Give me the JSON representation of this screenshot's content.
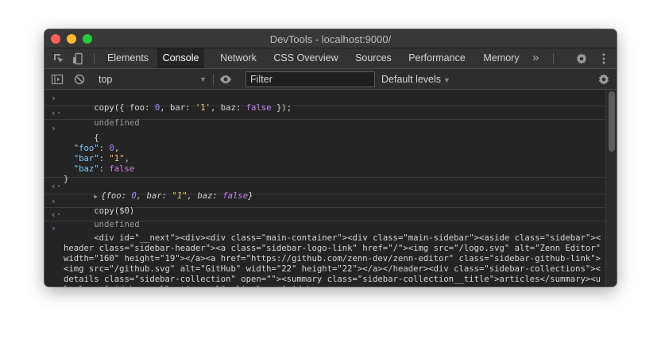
{
  "window": {
    "title": "DevTools - localhost:9000/"
  },
  "tabs": [
    {
      "label": "Elements"
    },
    {
      "label": "Console"
    },
    {
      "label": "Network"
    },
    {
      "label": "CSS Overview"
    },
    {
      "label": "Sources"
    },
    {
      "label": "Performance"
    },
    {
      "label": "Memory"
    }
  ],
  "more_tabs": "»",
  "toolbar": {
    "context": "top",
    "filter_placeholder": "Filter",
    "levels": "Default levels"
  },
  "console": {
    "entry1": {
      "cmd_prefix": "copy({ foo: ",
      "foo_val": "0",
      "bar_label": ", bar: ",
      "bar_val": "'1'",
      "baz_label": ", baz: ",
      "baz_val": "false",
      "cmd_suffix": " });"
    },
    "result1": "undefined",
    "json": {
      "open": "{",
      "k1": "\"foo\"",
      "v1": "0",
      "k2": "\"bar\"",
      "v2": "\"1\"",
      "k3": "\"baz\"",
      "v3": "false",
      "close": "}"
    },
    "obj": {
      "open": "{foo: ",
      "v1": "0",
      "mid1": ", bar: ",
      "v2": "\"1\"",
      "mid2": ", baz: ",
      "v3": "false",
      "close": "}"
    },
    "entry2": "copy($0)",
    "result2": "undefined",
    "html_output": "<div id=\"__next\"><div><div class=\"main-container\"><div class=\"main-sidebar\"><aside class=\"sidebar\"><header class=\"sidebar-header\"><a class=\"sidebar-logo-link\" href=\"/\"><img src=\"/logo.svg\" alt=\"Zenn Editor\" width=\"160\" height=\"19\"></a><a href=\"https://github.com/zenn-dev/zenn-editor\" class=\"sidebar-github-link\"><img src=\"/github.svg\" alt=\"GitHub\" width=\"22\" height=\"22\"></a></header><div class=\"sidebar-collections\"><details class=\"sidebar-collection\" open=\"\"><summary class=\"sidebar-collection__title\">articles</summary><ul class=\"sidebar-collection__ul\"><li class=\"sidebar-"
  }
}
